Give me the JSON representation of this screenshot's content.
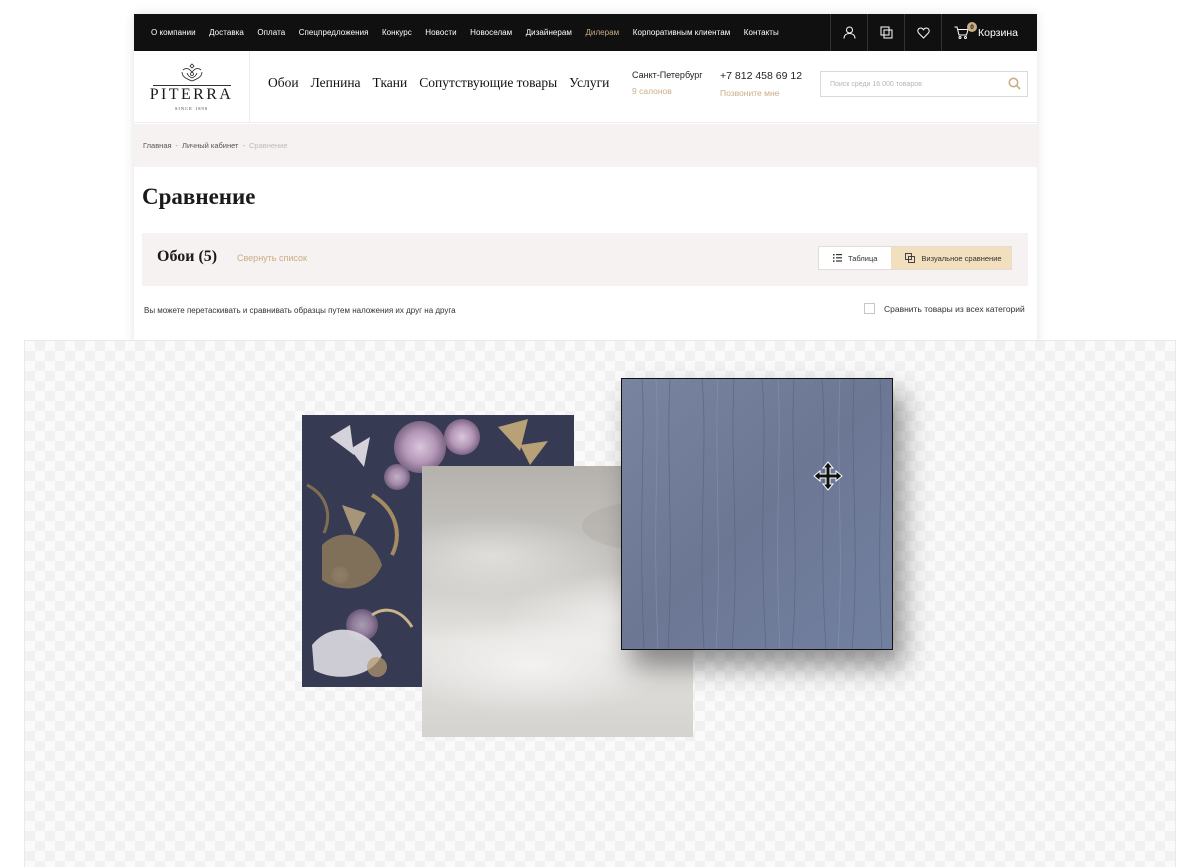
{
  "topbar": {
    "links": [
      "О компании",
      "Доставка",
      "Оплата",
      "Спецпредложения",
      "Конкурс",
      "Новости",
      "Новоселам",
      "Дизайнерам",
      "Дилерам",
      "Корпоративным клиентам",
      "Контакты"
    ],
    "accent_link_index": 8,
    "cart_label": "Корзина",
    "cart_count": "0"
  },
  "logo": {
    "text": "PITERRA",
    "since": "SINCE 1890"
  },
  "mainnav": [
    "Обои",
    "Лепнина",
    "Ткани",
    "Сопутствующие товары",
    "Услуги"
  ],
  "contacts": {
    "city": "Санкт-Петербург",
    "salons": "9 салонов",
    "phone": "+7 812 458 69 12",
    "callback": "Позвоните мне"
  },
  "search": {
    "placeholder": "Поиск среди 16 000 товаров"
  },
  "breadcrumbs": {
    "home": "Главная",
    "cabinet": "Личный кабинет",
    "current": "Сравнение"
  },
  "page": {
    "title": "Сравнение",
    "category_title": "Обои (5)",
    "collapse": "Свернуть список",
    "view_table": "Таблица",
    "view_visual": "Визуальное сравнение",
    "hint": "Вы можете перетаскивать и сравнивать образцы путем наложения их друг на друга",
    "all_categories": "Сравнить товары из всех категорий"
  },
  "colors": {
    "accent": "#c9ad84",
    "topbar": "#101010",
    "panel": "#f6f2f1",
    "active_view": "#f2dfbe"
  }
}
